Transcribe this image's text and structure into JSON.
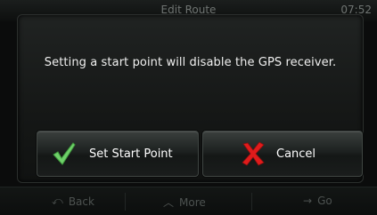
{
  "header": {
    "title": "Edit Route",
    "time": "07:52"
  },
  "dialog": {
    "message": "Setting a start point will disable the GPS receiver.",
    "confirm_label": "Set Start Point",
    "cancel_label": "Cancel"
  },
  "bottom_bar": {
    "back_label": "Back",
    "more_label": "More",
    "go_label": "Go"
  },
  "icons": {
    "confirm": "checkmark-icon",
    "cancel": "x-icon",
    "back": "back-arrow-icon",
    "more": "chevron-up-icon",
    "go": "right-arrow-icon"
  },
  "colors": {
    "check_green": "#6fd06a",
    "cancel_red": "#e01b1b",
    "background": "#0b0c0c"
  }
}
